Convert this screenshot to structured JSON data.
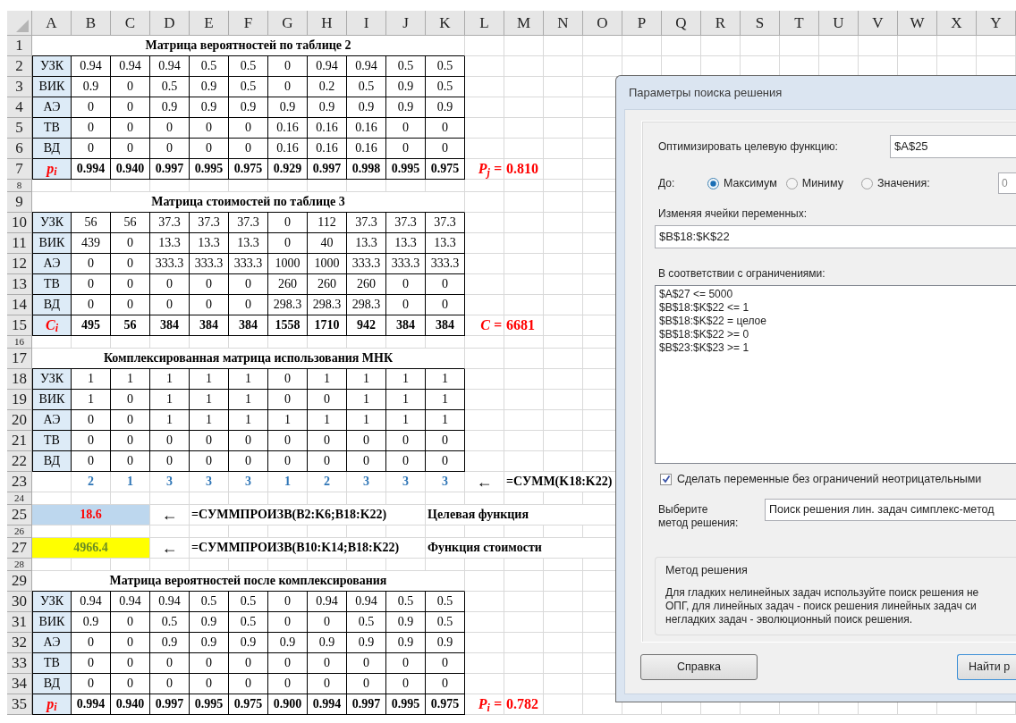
{
  "columns": [
    "A",
    "B",
    "C",
    "D",
    "E",
    "F",
    "G",
    "H",
    "I",
    "J",
    "K",
    "L",
    "M",
    "N",
    "O",
    "P",
    "Q",
    "R",
    "S",
    "T",
    "U",
    "V",
    "W",
    "X",
    "Y"
  ],
  "rows": [
    {
      "number": "1",
      "kind": "title",
      "text": "Матрица вероятностей по таблице 2"
    },
    {
      "number": "2",
      "kind": "data",
      "label": "УЗК",
      "values": [
        "0.94",
        "0.94",
        "0.94",
        "0.5",
        "0.5",
        "0",
        "0.94",
        "0.94",
        "0.5",
        "0.5"
      ]
    },
    {
      "number": "3",
      "kind": "data",
      "label": "ВИК",
      "values": [
        "0.9",
        "0",
        "0.5",
        "0.9",
        "0.5",
        "0",
        "0.2",
        "0.5",
        "0.9",
        "0.5"
      ]
    },
    {
      "number": "4",
      "kind": "data",
      "label": "АЭ",
      "values": [
        "0",
        "0",
        "0.9",
        "0.9",
        "0.9",
        "0.9",
        "0.9",
        "0.9",
        "0.9",
        "0.9"
      ]
    },
    {
      "number": "5",
      "kind": "data",
      "label": "ТВ",
      "values": [
        "0",
        "0",
        "0",
        "0",
        "0",
        "0.16",
        "0.16",
        "0.16",
        "0",
        "0"
      ]
    },
    {
      "number": "6",
      "kind": "data",
      "label": "ВД",
      "values": [
        "0",
        "0",
        "0",
        "0",
        "0",
        "0.16",
        "0.16",
        "0.16",
        "0",
        "0"
      ]
    },
    {
      "number": "7",
      "kind": "total",
      "label": "p$_{i}$",
      "values": [
        "0.994",
        "0.940",
        "0.997",
        "0.995",
        "0.975",
        "0.929",
        "0.997",
        "0.998",
        "0.995",
        "0.975"
      ],
      "param": {
        "label": "P$_{j}$ =",
        "value": "0.810"
      }
    },
    {
      "number": "8",
      "kind": "spacer"
    },
    {
      "number": "9",
      "kind": "title",
      "text": "Матрица стоимостей по таблице 3"
    },
    {
      "number": "10",
      "kind": "data",
      "label": "УЗК",
      "values": [
        "56",
        "56",
        "37.3",
        "37.3",
        "37.3",
        "0",
        "112",
        "37.3",
        "37.3",
        "37.3"
      ]
    },
    {
      "number": "11",
      "kind": "data",
      "label": "ВИК",
      "values": [
        "439",
        "0",
        "13.3",
        "13.3",
        "13.3",
        "0",
        "40",
        "13.3",
        "13.3",
        "13.3"
      ]
    },
    {
      "number": "12",
      "kind": "data",
      "label": "АЭ",
      "values": [
        "0",
        "0",
        "333.3",
        "333.3",
        "333.3",
        "1000",
        "1000",
        "333.3",
        "333.3",
        "333.3"
      ]
    },
    {
      "number": "13",
      "kind": "data",
      "label": "ТВ",
      "values": [
        "0",
        "0",
        "0",
        "0",
        "0",
        "260",
        "260",
        "260",
        "0",
        "0"
      ]
    },
    {
      "number": "14",
      "kind": "data",
      "label": "ВД",
      "values": [
        "0",
        "0",
        "0",
        "0",
        "0",
        "298.3",
        "298.3",
        "298.3",
        "0",
        "0"
      ]
    },
    {
      "number": "15",
      "kind": "total",
      "label": "C$_{i}$",
      "values": [
        "495",
        "56",
        "384",
        "384",
        "384",
        "1558",
        "1710",
        "942",
        "384",
        "384"
      ],
      "param": {
        "label": "C =",
        "value": "6681"
      }
    },
    {
      "number": "16",
      "kind": "spacer"
    },
    {
      "number": "17",
      "kind": "title",
      "text": "Комплексированная матрица использования МНК"
    },
    {
      "number": "18",
      "kind": "data",
      "label": "УЗК",
      "values": [
        "1",
        "1",
        "1",
        "1",
        "1",
        "0",
        "1",
        "1",
        "1",
        "1"
      ]
    },
    {
      "number": "19",
      "kind": "data",
      "label": "ВИК",
      "values": [
        "1",
        "0",
        "1",
        "1",
        "1",
        "0",
        "0",
        "1",
        "1",
        "1"
      ]
    },
    {
      "number": "20",
      "kind": "data",
      "label": "АЭ",
      "values": [
        "0",
        "0",
        "1",
        "1",
        "1",
        "1",
        "1",
        "1",
        "1",
        "1"
      ]
    },
    {
      "number": "21",
      "kind": "data",
      "label": "ТВ",
      "values": [
        "0",
        "0",
        "0",
        "0",
        "0",
        "0",
        "0",
        "0",
        "0",
        "0"
      ]
    },
    {
      "number": "22",
      "kind": "data",
      "label": "ВД",
      "values": [
        "0",
        "0",
        "0",
        "0",
        "0",
        "0",
        "0",
        "0",
        "0",
        "0"
      ]
    },
    {
      "number": "23",
      "kind": "sums",
      "values": [
        "2",
        "1",
        "3",
        "3",
        "3",
        "1",
        "2",
        "3",
        "3",
        "3"
      ],
      "sum_arrow": "←",
      "sum_formula": "=СУММ(K18:K22)"
    },
    {
      "number": "24",
      "kind": "spacer"
    },
    {
      "number": "25",
      "kind": "target",
      "value": "18.6",
      "arrow": "←",
      "formula": "=СУММПРОИЗВ(B2:K6;B18:K22)",
      "note": "Целевая функция"
    },
    {
      "number": "26",
      "kind": "spacer"
    },
    {
      "number": "27",
      "kind": "cost",
      "value": "4966.4",
      "arrow": "←",
      "formula": "=СУММПРОИЗВ(B10:K14;B18:K22)",
      "note": "Функция стоимости"
    },
    {
      "number": "28",
      "kind": "spacer"
    },
    {
      "number": "29",
      "kind": "title",
      "text": "Матрица вероятностей после комплексирования"
    },
    {
      "number": "30",
      "kind": "data",
      "label": "УЗК",
      "values": [
        "0.94",
        "0.94",
        "0.94",
        "0.5",
        "0.5",
        "0",
        "0.94",
        "0.94",
        "0.5",
        "0.5"
      ]
    },
    {
      "number": "31",
      "kind": "data",
      "label": "ВИК",
      "values": [
        "0.9",
        "0",
        "0.5",
        "0.9",
        "0.5",
        "0",
        "0",
        "0.5",
        "0.9",
        "0.5"
      ]
    },
    {
      "number": "32",
      "kind": "data",
      "label": "АЭ",
      "values": [
        "0",
        "0",
        "0.9",
        "0.9",
        "0.9",
        "0.9",
        "0.9",
        "0.9",
        "0.9",
        "0.9"
      ]
    },
    {
      "number": "33",
      "kind": "data",
      "label": "ТВ",
      "values": [
        "0",
        "0",
        "0",
        "0",
        "0",
        "0",
        "0",
        "0",
        "0",
        "0"
      ]
    },
    {
      "number": "34",
      "kind": "data",
      "label": "ВД",
      "values": [
        "0",
        "0",
        "0",
        "0",
        "0",
        "0",
        "0",
        "0",
        "0",
        "0"
      ]
    },
    {
      "number": "35",
      "kind": "total",
      "label": "p$_{i}$",
      "values": [
        "0.994",
        "0.940",
        "0.997",
        "0.995",
        "0.975",
        "0.900",
        "0.994",
        "0.997",
        "0.995",
        "0.975"
      ],
      "param": {
        "label": "P$_{i}$ =",
        "value": "0.782"
      }
    }
  ],
  "dialog": {
    "title": "Параметры поиска решения",
    "objective": {
      "label": "Оптимизировать целевую функцию:",
      "value": "$A$25"
    },
    "to": {
      "label": "До:",
      "options": [
        {
          "label": "Максимум",
          "selected": true
        },
        {
          "label": "Миниму",
          "selected": false
        },
        {
          "label": "Значения:",
          "selected": false
        }
      ],
      "value_field": {
        "value": "0",
        "disabled": true
      }
    },
    "variables": {
      "label": "Изменяя ячейки переменных:",
      "value": "$B$18:$K$22"
    },
    "constraints": {
      "label": "В соответствии с ограничениями:",
      "items": [
        "$A$27 <= 5000",
        "$B$18:$K$22 <= 1",
        "$B$18:$K$22 = целое",
        "$B$18:$K$22 >= 0",
        "$B$23:$K$23 >= 1"
      ]
    },
    "nonnegative": {
      "label": "Сделать переменные без ограничений неотрицательными",
      "checked": true
    },
    "method": {
      "label_lines": [
        "Выберите",
        "метод решения:"
      ],
      "value": "Поиск решения лин. задач симплекс-метод"
    },
    "method_info": {
      "title": "Метод решения",
      "lines": [
        "Для гладких нелинейных задач используйте поиск решения не",
        "ОПГ, для линейных задач - поиск решения линейных задач си",
        "негладких задач - эволюционный поиск решения."
      ]
    },
    "buttons": [
      {
        "label": "Справка",
        "default": false
      },
      {
        "label": "Найти р",
        "default": true
      }
    ]
  }
}
